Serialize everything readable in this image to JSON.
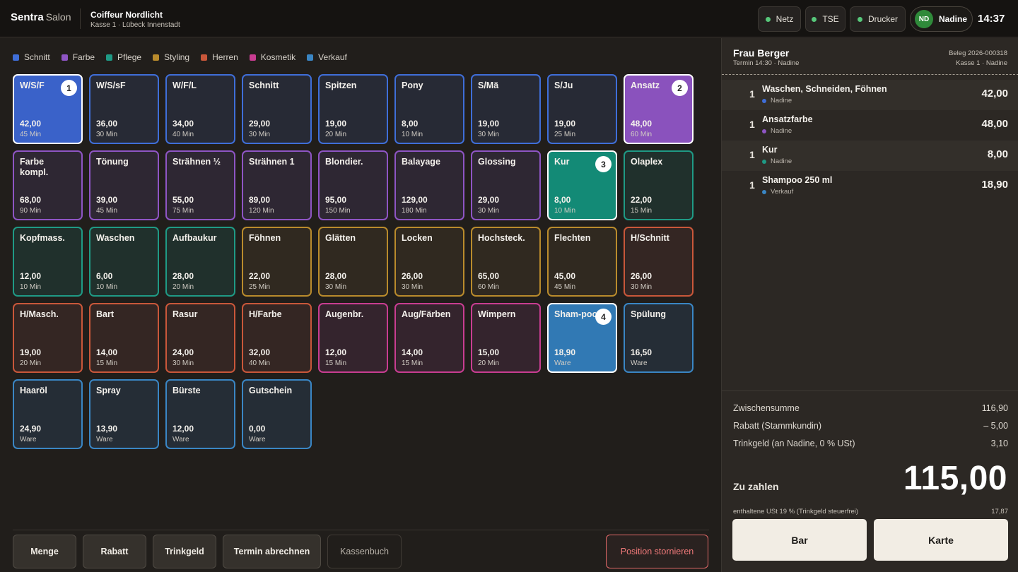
{
  "header": {
    "brand": "Sentra",
    "brand_suffix": "Salon",
    "shop_name": "Coiffeur Nordlicht",
    "shop_sub": "Kasse 1 · Lübeck Innenstadt",
    "status": [
      "Netz",
      "TSE",
      "Drucker"
    ],
    "user_initials": "ND",
    "user_name": "Nadine",
    "clock": "14:37"
  },
  "legend": [
    {
      "label": "Schnitt",
      "color": "#3f6ed8"
    },
    {
      "label": "Farbe",
      "color": "#8e55c4"
    },
    {
      "label": "Pflege",
      "color": "#1f9a85"
    },
    {
      "label": "Styling",
      "color": "#b98b2c"
    },
    {
      "label": "Herren",
      "color": "#c9573a"
    },
    {
      "label": "Kosmetik",
      "color": "#c83d91"
    },
    {
      "label": "Verkauf",
      "color": "#3a86c4"
    }
  ],
  "tiles": [
    {
      "name": "W/S/F",
      "price": "42,00",
      "dur": "45 Min",
      "cat": "schnitt",
      "badge": "1"
    },
    {
      "name": "W/S/sF",
      "price": "36,00",
      "dur": "30 Min",
      "cat": "schnitt"
    },
    {
      "name": "W/F/L",
      "price": "34,00",
      "dur": "40 Min",
      "cat": "schnitt"
    },
    {
      "name": "Schnitt",
      "price": "29,00",
      "dur": "30 Min",
      "cat": "schnitt"
    },
    {
      "name": "Spitzen",
      "price": "19,00",
      "dur": "20 Min",
      "cat": "schnitt"
    },
    {
      "name": "Pony",
      "price": "8,00",
      "dur": "10 Min",
      "cat": "schnitt"
    },
    {
      "name": "S/Mä",
      "price": "19,00",
      "dur": "30 Min",
      "cat": "schnitt"
    },
    {
      "name": "S/Ju",
      "price": "19,00",
      "dur": "25 Min",
      "cat": "schnitt"
    },
    {
      "name": "Ansatz",
      "price": "48,00",
      "dur": "60 Min",
      "cat": "farbe",
      "badge": "2"
    },
    {
      "name": "Farbe kompl.",
      "price": "68,00",
      "dur": "90 Min",
      "cat": "farbe"
    },
    {
      "name": "Tönung",
      "price": "39,00",
      "dur": "45 Min",
      "cat": "farbe"
    },
    {
      "name": "Strähnen ½",
      "price": "55,00",
      "dur": "75 Min",
      "cat": "farbe"
    },
    {
      "name": "Strähnen 1",
      "price": "89,00",
      "dur": "120 Min",
      "cat": "farbe"
    },
    {
      "name": "Blondier.",
      "price": "95,00",
      "dur": "150 Min",
      "cat": "farbe"
    },
    {
      "name": "Balayage",
      "price": "129,00",
      "dur": "180 Min",
      "cat": "farbe"
    },
    {
      "name": "Glossing",
      "price": "29,00",
      "dur": "30 Min",
      "cat": "farbe"
    },
    {
      "name": "Kur",
      "price": "8,00",
      "dur": "10 Min",
      "cat": "pflege",
      "badge": "3"
    },
    {
      "name": "Olaplex",
      "price": "22,00",
      "dur": "15 Min",
      "cat": "pflege"
    },
    {
      "name": "Kopfmass.",
      "price": "12,00",
      "dur": "10 Min",
      "cat": "pflege"
    },
    {
      "name": "Waschen",
      "price": "6,00",
      "dur": "10 Min",
      "cat": "pflege"
    },
    {
      "name": "Aufbaukur",
      "price": "28,00",
      "dur": "20 Min",
      "cat": "pflege"
    },
    {
      "name": "Föhnen",
      "price": "22,00",
      "dur": "25 Min",
      "cat": "styling"
    },
    {
      "name": "Glätten",
      "price": "28,00",
      "dur": "30 Min",
      "cat": "styling"
    },
    {
      "name": "Locken",
      "price": "26,00",
      "dur": "30 Min",
      "cat": "styling"
    },
    {
      "name": "Hochsteck.",
      "price": "65,00",
      "dur": "60 Min",
      "cat": "styling"
    },
    {
      "name": "Flechten",
      "price": "45,00",
      "dur": "45 Min",
      "cat": "styling"
    },
    {
      "name": "H/Schnitt",
      "price": "26,00",
      "dur": "30 Min",
      "cat": "herren"
    },
    {
      "name": "H/Masch.",
      "price": "19,00",
      "dur": "20 Min",
      "cat": "herren"
    },
    {
      "name": "Bart",
      "price": "14,00",
      "dur": "15 Min",
      "cat": "herren"
    },
    {
      "name": "Rasur",
      "price": "24,00",
      "dur": "30 Min",
      "cat": "herren"
    },
    {
      "name": "H/Farbe",
      "price": "32,00",
      "dur": "40 Min",
      "cat": "herren"
    },
    {
      "name": "Augenbr.",
      "price": "12,00",
      "dur": "15 Min",
      "cat": "kosmetik"
    },
    {
      "name": "Aug/Färben",
      "price": "14,00",
      "dur": "15 Min",
      "cat": "kosmetik"
    },
    {
      "name": "Wimpern",
      "price": "15,00",
      "dur": "20 Min",
      "cat": "kosmetik"
    },
    {
      "name": "Sham-poo",
      "price": "18,90",
      "dur": "Ware",
      "cat": "verkauf",
      "badge": "4"
    },
    {
      "name": "Spülung",
      "price": "16,50",
      "dur": "Ware",
      "cat": "verkauf"
    },
    {
      "name": "Haaröl",
      "price": "24,90",
      "dur": "Ware",
      "cat": "verkauf"
    },
    {
      "name": "Spray",
      "price": "13,90",
      "dur": "Ware",
      "cat": "verkauf"
    },
    {
      "name": "Bürste",
      "price": "12,00",
      "dur": "Ware",
      "cat": "verkauf"
    },
    {
      "name": "Gutschein",
      "price": "0,00",
      "dur": "Ware",
      "cat": "verkauf"
    }
  ],
  "actions": {
    "menge": "Menge",
    "rabatt": "Rabatt",
    "trinkgeld": "Trinkgeld",
    "termin": "Termin abrechnen",
    "kassenbuch": "Kassenbuch",
    "storno": "Position stornieren"
  },
  "receipt": {
    "customer": "Frau Berger",
    "customer_sub": "Termin 14:30 · Nadine",
    "beleg": "Beleg 2026-000318",
    "kasse": "Kasse 1 · Nadine",
    "items": [
      {
        "qty": "1",
        "title": "Waschen, Schneiden, Föhnen",
        "sub": "Nadine",
        "color": "#3f6ed8",
        "amount": "42,00"
      },
      {
        "qty": "1",
        "title": "Ansatzfarbe",
        "sub": "Nadine",
        "color": "#8e55c4",
        "amount": "48,00"
      },
      {
        "qty": "1",
        "title": "Kur",
        "sub": "Nadine",
        "color": "#1f9a85",
        "amount": "8,00"
      },
      {
        "qty": "1",
        "title": "Shampoo 250 ml",
        "sub": "Verkauf",
        "color": "#3a86c4",
        "amount": "18,90"
      }
    ],
    "subtotal_label": "Zwischensumme",
    "subtotal": "116,90",
    "discount_label": "Rabatt (Stammkundin)",
    "discount": "– 5,00",
    "tip_label": "Trinkgeld (an Nadine, 0 % USt)",
    "tip": "3,10",
    "total_label": "Zu zahlen",
    "total": "115,00",
    "vat_label": "enthaltene USt 19 % (Trinkgeld steuerfrei)",
    "vat": "17,87",
    "pay_cash": "Bar",
    "pay_card": "Karte"
  },
  "colors": {
    "schnitt": {
      "border": "#3f6ed8",
      "bg": "#272a35",
      "sel": "#3a62c9"
    },
    "farbe": {
      "border": "#8e55c4",
      "bg": "#2e2733",
      "sel": "#8a52bd"
    },
    "pflege": {
      "border": "#1f9a85",
      "bg": "#20302c",
      "sel": "#138a76"
    },
    "styling": {
      "border": "#b98b2c",
      "bg": "#302920",
      "sel": "#a57a23"
    },
    "herren": {
      "border": "#c9573a",
      "bg": "#342623",
      "sel": "#b34e36"
    },
    "kosmetik": {
      "border": "#c83d91",
      "bg": "#34242d",
      "sel": "#b23a83"
    },
    "verkauf": {
      "border": "#3a86c4",
      "bg": "#252d36",
      "sel": "#3179b4"
    }
  }
}
